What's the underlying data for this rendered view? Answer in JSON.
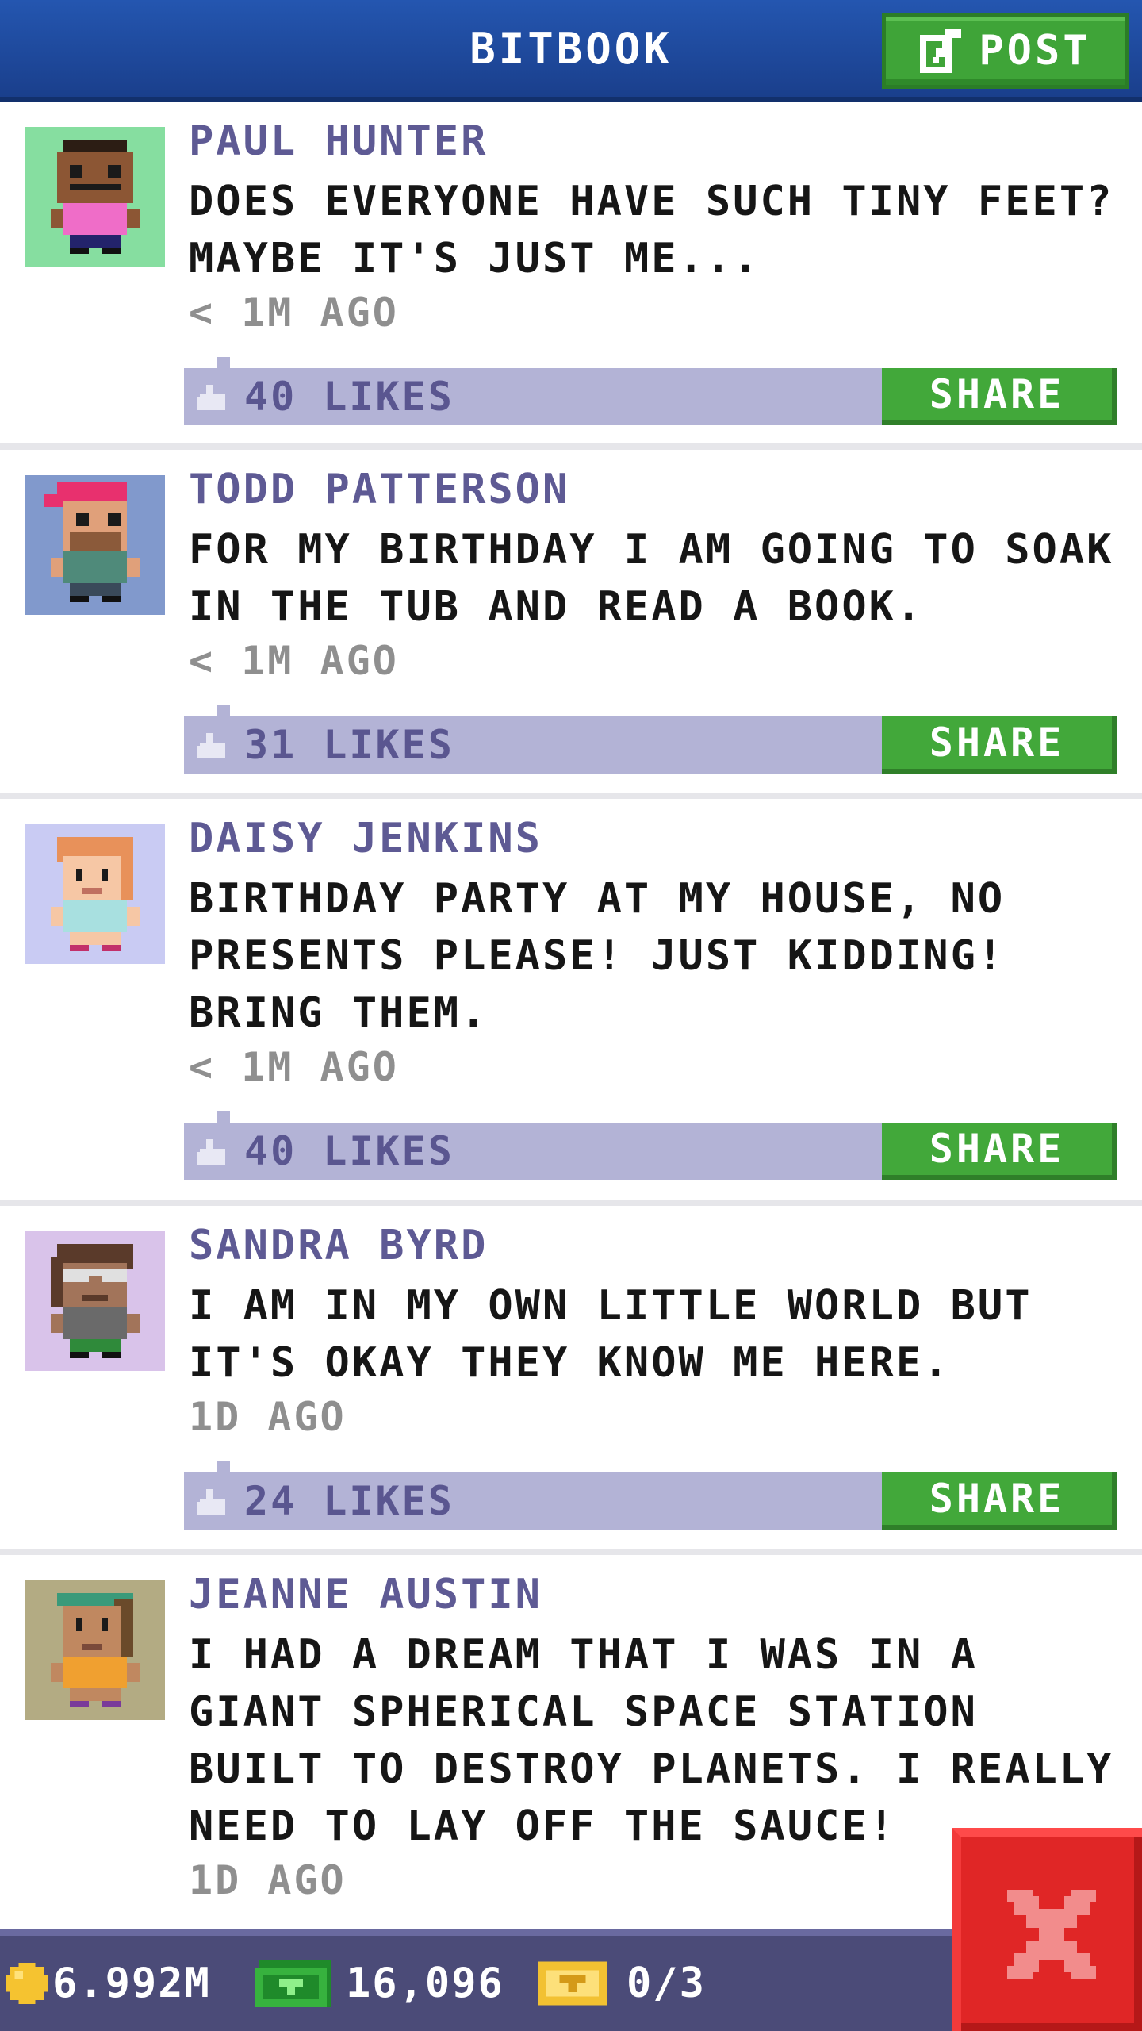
{
  "header": {
    "title": "BITBOOK",
    "post_label": "POST"
  },
  "posts": [
    {
      "name": "PAUL HUNTER",
      "text": "DOES EVERYONE HAVE SUCH TINY FEET? MAYBE IT'S JUST ME...",
      "time": "< 1M AGO",
      "likes": "40 LIKES",
      "share": "SHARE",
      "avatar_bg": "#86dea0",
      "avatar": "man-pink-shirt-mustache"
    },
    {
      "name": "TODD PATTERSON",
      "text": "FOR MY BIRTHDAY I AM GOING TO SOAK IN THE TUB AND READ A BOOK.",
      "time": "< 1M AGO",
      "likes": "31 LIKES",
      "share": "SHARE",
      "avatar_bg": "#8199cc",
      "avatar": "man-pink-cap-beard"
    },
    {
      "name": "DAISY JENKINS",
      "text": "BIRTHDAY PARTY AT MY HOUSE, NO PRESENTS PLEASE! JUST KIDDING! BRING THEM.",
      "time": "< 1M AGO",
      "likes": "40 LIKES",
      "share": "SHARE",
      "avatar_bg": "#c9cbf3",
      "avatar": "woman-red-hair"
    },
    {
      "name": "SANDRA BYRD",
      "text": "I AM IN MY OWN LITTLE WORLD BUT IT'S OKAY THEY KNOW ME HERE.",
      "time": "1D AGO",
      "likes": "24 LIKES",
      "share": "SHARE",
      "avatar_bg": "#d9c3ea",
      "avatar": "woman-glasses"
    },
    {
      "name": "JEANNE AUSTIN",
      "text": "I HAD A DREAM THAT I WAS IN A GIANT SPHERICAL SPACE STATION BUILT TO DESTROY PLANETS. I REALLY NEED TO LAY OFF THE SAUCE!",
      "time": "1D AGO",
      "likes": "",
      "share": "",
      "avatar_bg": "#b3ab83",
      "avatar": "woman-green-headband"
    }
  ],
  "status": {
    "coins": "6.992M",
    "bux": "16,096",
    "tickets": "0/3"
  },
  "colors": {
    "header_blue": "#1f4ea6",
    "share_green": "#42a83a",
    "likes_bar": "#b3b3d6",
    "name_purple": "#5e5a94",
    "close_red": "#e02626"
  },
  "icons": {
    "post": "edit-icon",
    "like": "thumbs-up-icon",
    "coin": "coin-icon",
    "bux": "bux-icon",
    "ticket": "ticket-icon",
    "close": "close-icon"
  }
}
